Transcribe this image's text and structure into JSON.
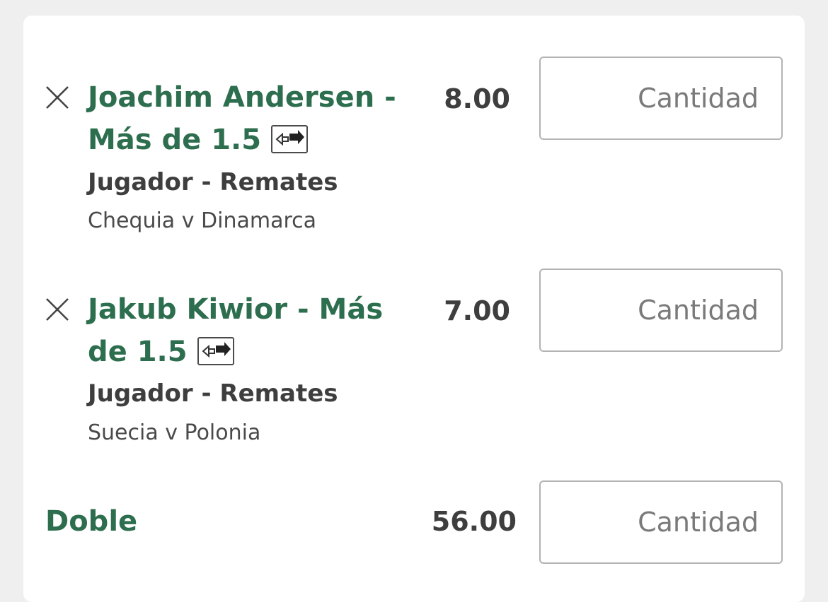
{
  "selections": [
    {
      "title": "Joachim Andersen - Más de 1.5",
      "market": "Jugador - Remates",
      "event": "Chequia v Dinamarca",
      "odds": "8.00",
      "stake_placeholder": "Cantidad",
      "remove_icon": "close-icon",
      "swap_icon": "swap-icon"
    },
    {
      "title": "Jakub Kiwior - Más de 1.5",
      "market": "Jugador - Remates",
      "event": "Suecia v Polonia",
      "odds": "7.00",
      "stake_placeholder": "Cantidad",
      "remove_icon": "close-icon",
      "swap_icon": "swap-icon"
    }
  ],
  "multiple": {
    "label": "Doble",
    "odds": "56.00",
    "stake_placeholder": "Cantidad"
  },
  "colors": {
    "background": "#efefef",
    "card": "#ffffff",
    "accent_green": "#2d6e4f",
    "text_dark": "#3e3e3e",
    "input_border": "#b3b3b3",
    "placeholder": "#7a7a7a"
  }
}
